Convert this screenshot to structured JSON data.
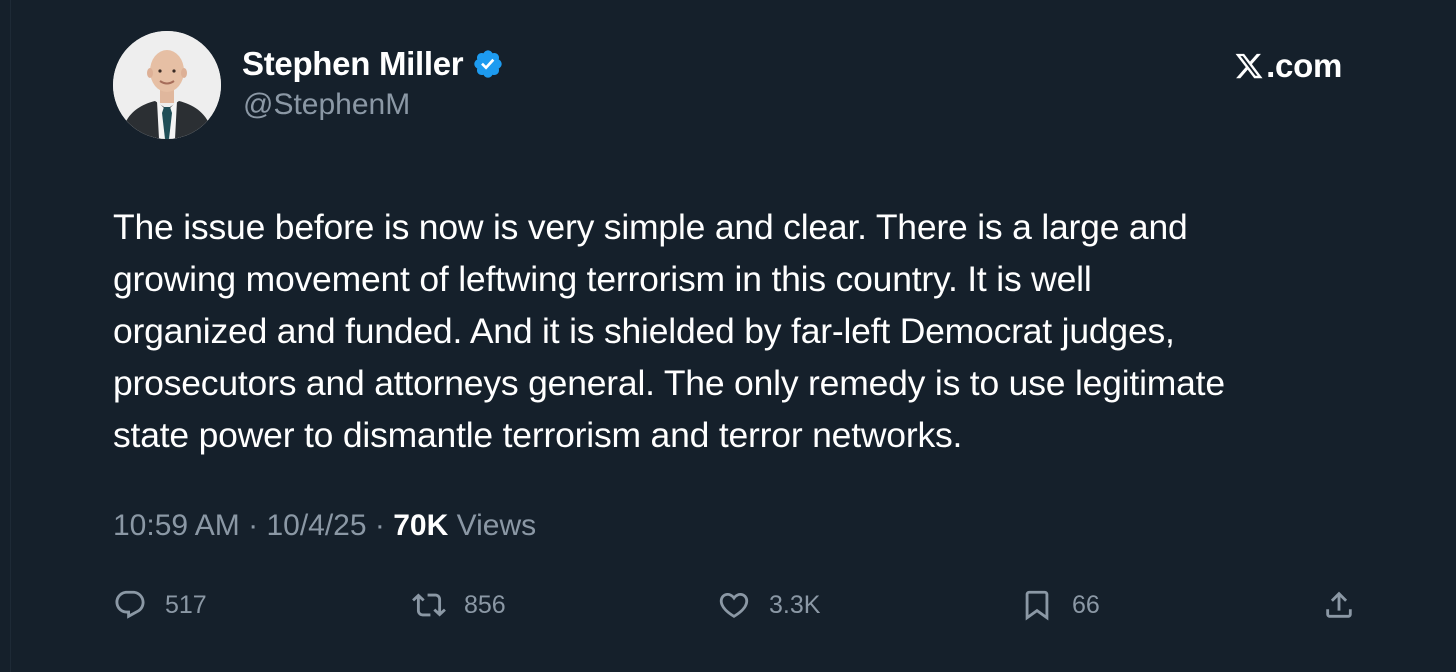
{
  "author": {
    "display_name": "Stephen Miller",
    "handle": "@StephenM",
    "verified": true
  },
  "brand": {
    "label": ".com",
    "logo_icon": "x-logo-icon"
  },
  "tweet": {
    "text_lines": [
      "The issue before is now is very simple and clear. There is a large and",
      "growing movement of leftwing terrorism in this country. It is well",
      "organized and funded. And it is shielded by far-left Democrat judges,",
      "prosecutors and attorneys general. The only remedy is to use legitimate",
      "state power to dismantle terrorism and terror networks."
    ]
  },
  "meta": {
    "time": "10:59 AM",
    "separator": "·",
    "date": "10/4/25",
    "views_count": "70K",
    "views_label": "Views"
  },
  "actions": {
    "reply_count": "517",
    "retweet_count": "856",
    "like_count": "3.3K",
    "bookmark_count": "66"
  },
  "colors": {
    "background": "#15202b",
    "text_primary": "#ffffff",
    "text_secondary": "#8b98a5",
    "verified_badge": "#1d9bf0"
  }
}
